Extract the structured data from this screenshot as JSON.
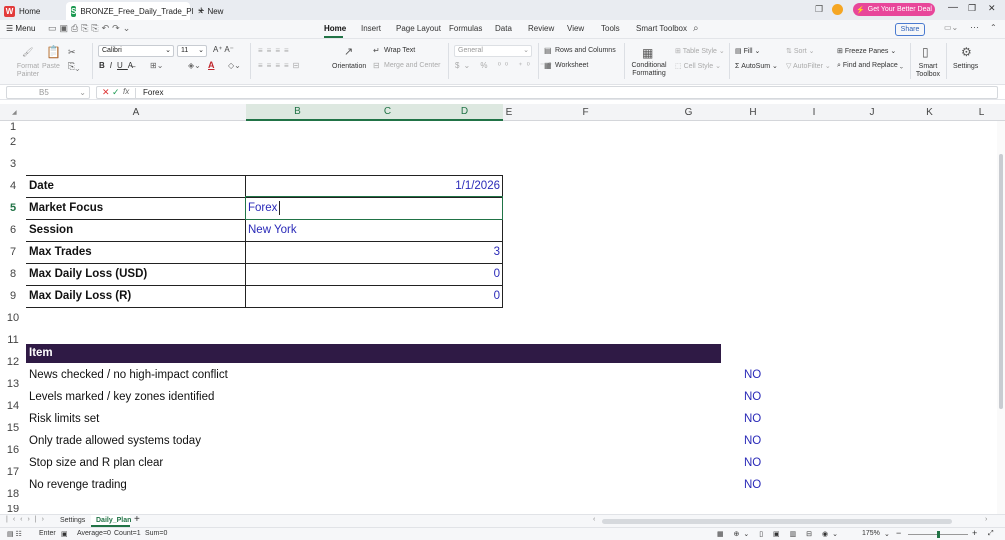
{
  "titlebar": {
    "home_tab": "Home",
    "file_tab": "BRONZE_Free_Daily_Trade_Pl",
    "new_tab": "New",
    "promo": "Get Your Better Deal"
  },
  "menubar": {
    "menu": "Menu",
    "tabs": [
      "Home",
      "Insert",
      "Page Layout",
      "Formulas",
      "Data",
      "Review",
      "View",
      "Tools",
      "Smart Toolbox"
    ],
    "share": "Share"
  },
  "ribbon": {
    "format_painter": "Format Painter",
    "paste": "Paste",
    "font_name": "Calibri",
    "font_size": "11",
    "wrap_text": "Wrap Text",
    "merge_center": "Merge and Center",
    "orientation": "Orientation",
    "number_format": "General",
    "rows_columns": "Rows and Columns",
    "worksheet": "Worksheet",
    "conditional_formatting": "Conditional Formatting",
    "table_style": "Table Style",
    "cell_style": "Cell Style",
    "fill": "Fill",
    "autosum": "AutoSum",
    "sort": "Sort",
    "autofilter": "AutoFilter",
    "freeze_panes": "Freeze Panes",
    "find_replace": "Find and Replace",
    "smart_toolbox": "Smart Toolbox",
    "settings": "Settings"
  },
  "formula_bar": {
    "name_box": "B5",
    "fx": "fx",
    "content": "Forex"
  },
  "grid": {
    "columns": [
      "A",
      "B",
      "C",
      "D",
      "E",
      "F",
      "G",
      "H",
      "I",
      "J",
      "K",
      "L"
    ],
    "rows": [
      "1",
      "2",
      "3",
      "4",
      "5",
      "6",
      "7",
      "8",
      "9",
      "10",
      "11",
      "12",
      "13",
      "14",
      "15",
      "16",
      "17",
      "18",
      "19"
    ],
    "plan": [
      {
        "label": "Date",
        "value": "1/1/2026",
        "align": "right"
      },
      {
        "label": "Market Focus",
        "value": "Forex",
        "align": "left"
      },
      {
        "label": "Session",
        "value": "New York",
        "align": "left"
      },
      {
        "label": "Max Trades",
        "value": "3",
        "align": "right"
      },
      {
        "label": "Max Daily Loss (USD)",
        "value": "0",
        "align": "right"
      },
      {
        "label": "Max Daily Loss (R)",
        "value": "0",
        "align": "right"
      }
    ],
    "checklist_header": "Item",
    "checklist": [
      {
        "item": "News checked / no high-impact conflict",
        "status": "NO"
      },
      {
        "item": "Levels marked / key zones identified",
        "status": "NO"
      },
      {
        "item": "Risk limits set",
        "status": "NO"
      },
      {
        "item": "Only trade allowed systems today",
        "status": "NO"
      },
      {
        "item": "Stop size and R plan clear",
        "status": "NO"
      },
      {
        "item": "No revenge trading",
        "status": "NO"
      }
    ]
  },
  "sheets": [
    "Settings",
    "Daily_Plan"
  ],
  "status": {
    "mode": "Enter",
    "average": "Average=0",
    "count": "Count=1",
    "sum": "Sum=0",
    "zoom": "175%"
  },
  "colors": {
    "header_bg": "#2f1a45",
    "value_blue": "#2a2ab8",
    "select_green": "#217346"
  }
}
